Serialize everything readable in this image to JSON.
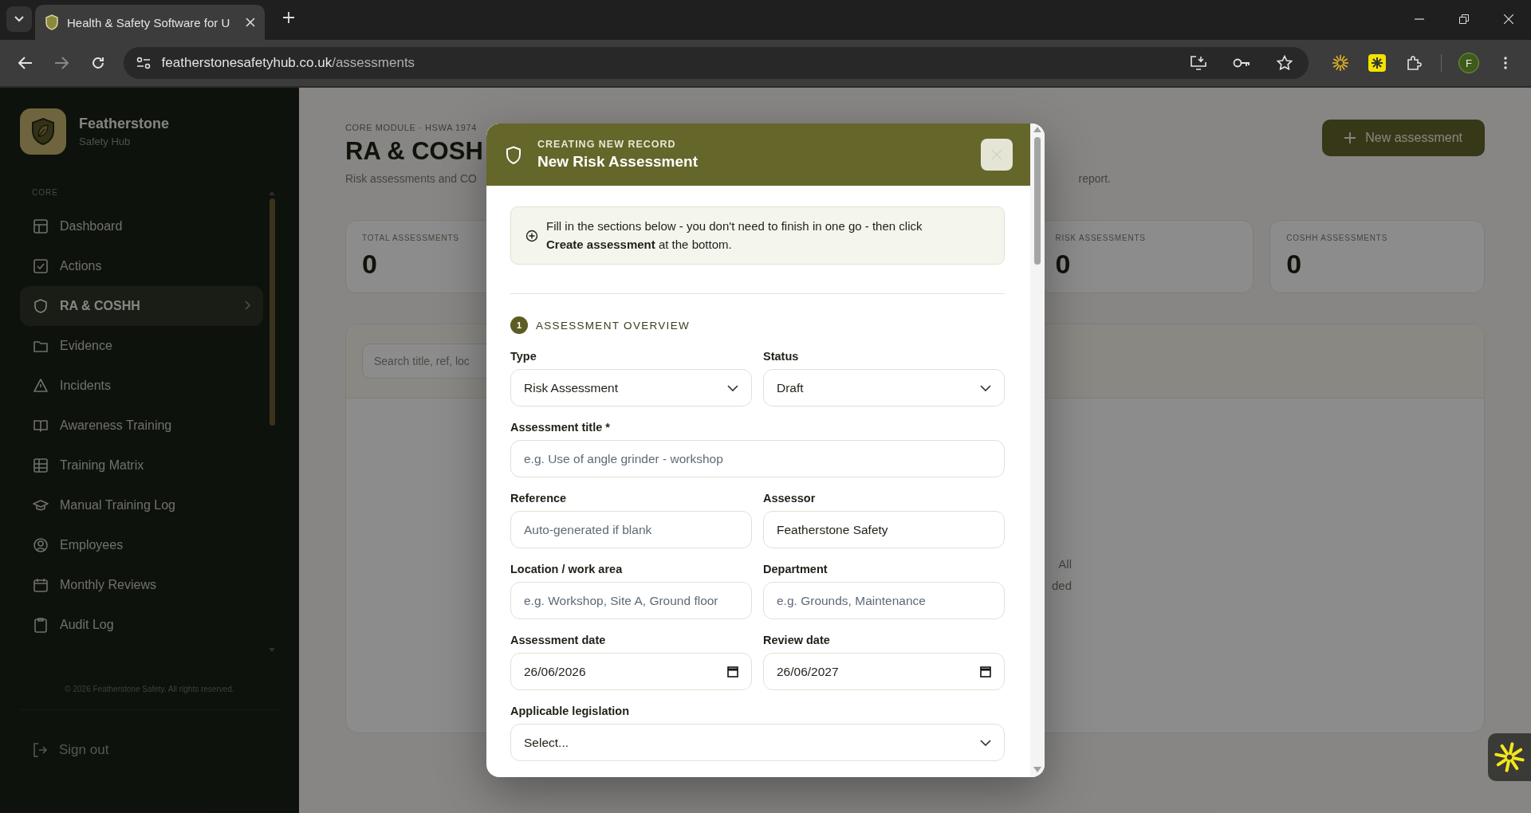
{
  "browser": {
    "tab_title": "Health & Safety Software for U",
    "url_host": "featherstonesafetyhub.co.uk",
    "url_path": "/assessments",
    "profile_initial": "F"
  },
  "sidebar": {
    "brand": "Featherstone",
    "tagline": "Safety Hub",
    "section": "CORE",
    "items": [
      {
        "label": "Dashboard",
        "selected": false
      },
      {
        "label": "Actions",
        "selected": false
      },
      {
        "label": "RA & COSHH",
        "selected": true
      },
      {
        "label": "Evidence",
        "selected": false
      },
      {
        "label": "Incidents",
        "selected": false
      },
      {
        "label": "Awareness Training",
        "selected": false
      },
      {
        "label": "Training Matrix",
        "selected": false
      },
      {
        "label": "Manual Training Log",
        "selected": false
      },
      {
        "label": "Employees",
        "selected": false
      },
      {
        "label": "Monthly Reviews",
        "selected": false
      },
      {
        "label": "Audit Log",
        "selected": false
      }
    ],
    "footer": "© 2026 Featherstone Safety. All rights reserved.",
    "sign_out": "Sign out"
  },
  "page": {
    "breadcrumb": "CORE MODULE · HSWA 1974",
    "title": "RA & COSH",
    "subtitle_start": "Risk assessments and CO",
    "subtitle_end": "report.",
    "new_button": "New assessment",
    "stats": [
      {
        "label": "TOTAL ASSESSMENTS",
        "value": "0"
      },
      {
        "label": "RISK ASSESSMENTS",
        "value": "0"
      },
      {
        "label": "COSHH ASSESSMENTS",
        "value": "0"
      }
    ],
    "search_placeholder": "Search title, ref, loc",
    "empty_fragments": [
      "All",
      "ded"
    ]
  },
  "modal": {
    "eyebrow": "CREATING NEW RECORD",
    "title": "New Risk Assessment",
    "notice": "Fill in the sections below - you don't need to finish in one go - then click **Create assessment** at the bottom.",
    "section": {
      "number": "1",
      "title": "ASSESSMENT OVERVIEW"
    },
    "rows": [
      [
        {
          "label": "Type",
          "kind": "select",
          "value": "Risk Assessment"
        },
        {
          "label": "Status",
          "kind": "select",
          "value": "Draft"
        }
      ],
      [
        {
          "label": "Assessment title *",
          "kind": "text",
          "placeholder": "e.g. Use of angle grinder - workshop"
        }
      ],
      [
        {
          "label": "Reference",
          "kind": "text",
          "placeholder": "Auto-generated if blank"
        },
        {
          "label": "Assessor",
          "kind": "text",
          "value": "Featherstone Safety"
        }
      ],
      [
        {
          "label": "Location / work area",
          "kind": "text",
          "placeholder": "e.g. Workshop, Site A, Ground floor"
        },
        {
          "label": "Department",
          "kind": "text",
          "placeholder": "e.g. Grounds, Maintenance"
        }
      ],
      [
        {
          "label": "Assessment date",
          "kind": "date",
          "value": "26/06/2026"
        },
        {
          "label": "Review date",
          "kind": "date",
          "value": "26/06/2027"
        }
      ],
      [
        {
          "label": "Applicable legislation",
          "kind": "select",
          "value": "Select..."
        }
      ]
    ]
  }
}
